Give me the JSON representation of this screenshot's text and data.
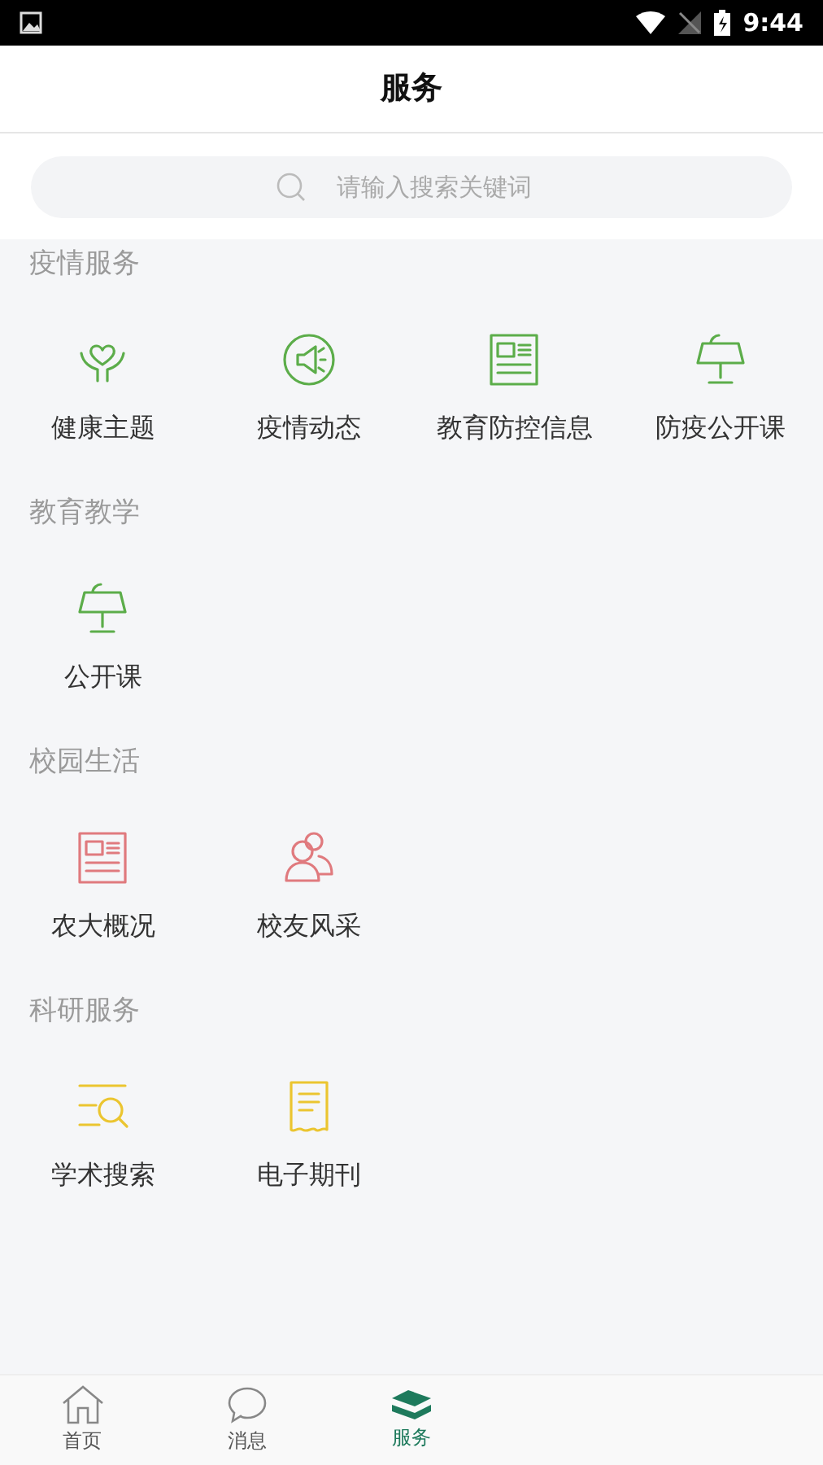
{
  "status_bar": {
    "time": "9:44"
  },
  "header": {
    "title": "服务"
  },
  "search": {
    "placeholder": "请输入搜索关键词"
  },
  "sections": [
    {
      "title": "疫情服务",
      "color": "#5cad4a",
      "items": [
        {
          "label": "健康主题",
          "kind": "heart"
        },
        {
          "label": "疫情动态",
          "kind": "megaphone"
        },
        {
          "label": "教育防控信息",
          "kind": "news"
        },
        {
          "label": "防疫公开课",
          "kind": "lectern"
        }
      ]
    },
    {
      "title": "教育教学",
      "color": "#5cad4a",
      "items": [
        {
          "label": "公开课",
          "kind": "lectern"
        }
      ]
    },
    {
      "title": "校园生活",
      "color": "#e07a7e",
      "items": [
        {
          "label": "农大概况",
          "kind": "news"
        },
        {
          "label": "校友风采",
          "kind": "people"
        }
      ]
    },
    {
      "title": "科研服务",
      "color": "#ebc530",
      "items": [
        {
          "label": "学术搜索",
          "kind": "search"
        },
        {
          "label": "电子期刊",
          "kind": "receipt"
        }
      ]
    }
  ],
  "tabs": [
    {
      "label": "首页",
      "kind": "home",
      "selected": false
    },
    {
      "label": "消息",
      "kind": "chat",
      "selected": false
    },
    {
      "label": "服务",
      "kind": "layers",
      "selected": true
    }
  ]
}
